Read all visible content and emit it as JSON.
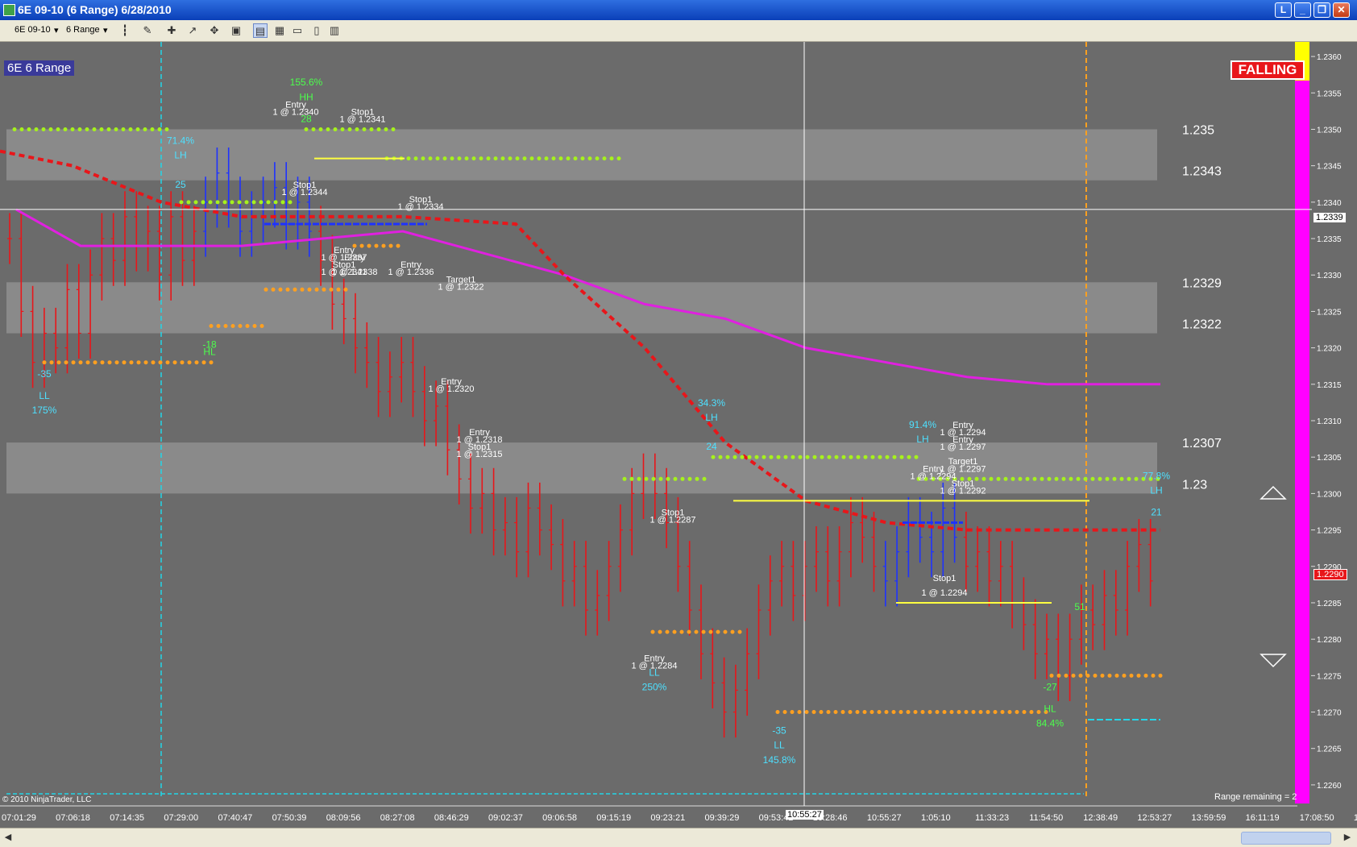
{
  "window": {
    "title": "6E 09-10 (6 Range)  6/28/2010",
    "btn_l": "L"
  },
  "toolbar": {
    "instrument": "6E 09-10",
    "period": "6 Range"
  },
  "chart": {
    "label": "6E 6 Range",
    "status": "FALLING",
    "copyright": "© 2010 NinjaTrader, LLC",
    "range_remaining": "Range remaining = 2",
    "crosshair_time": "10:55:27",
    "crosshair_price": "1.2339",
    "current_price": "1.2290"
  },
  "chart_data": {
    "type": "bar",
    "title": "",
    "ylim": [
      1.2258,
      1.2362
    ],
    "y_ticks": [
      1.236,
      1.2355,
      1.235,
      1.2345,
      1.234,
      1.2335,
      1.233,
      1.2325,
      1.232,
      1.2315,
      1.231,
      1.2305,
      1.23,
      1.2295,
      1.229,
      1.2285,
      1.228,
      1.2275,
      1.227,
      1.2265,
      1.226
    ],
    "x_labels": [
      "07:01:29",
      "07:06:18",
      "07:14:35",
      "07:29:00",
      "07:40:47",
      "07:50:39",
      "08:09:56",
      "08:27:08",
      "08:46:29",
      "09:02:37",
      "09:06:58",
      "09:15:19",
      "09:23:21",
      "09:39:29",
      "09:53:42",
      "10:28:46",
      "10:55:27",
      "1:05:10",
      "11:33:23",
      "11:54:50",
      "12:38:49",
      "12:53:27",
      "13:59:59",
      "16:11:19",
      "17:08:50",
      "17:14:55"
    ],
    "zones": [
      {
        "from": 1.2343,
        "to": 1.235,
        "label": "1.2343",
        "label_hi": "1.235"
      },
      {
        "from": 1.2322,
        "to": 1.2329,
        "label": "1.2322",
        "label_hi": "1.2329"
      },
      {
        "from": 1.23,
        "to": 1.2307,
        "label": "1.23",
        "label_hi": "1.2307"
      }
    ],
    "price_path": [
      1.2335,
      1.2325,
      1.2318,
      1.2322,
      1.232,
      1.2328,
      1.2322,
      1.233,
      1.2335,
      1.2332,
      1.2338,
      1.2334,
      1.2336,
      1.233,
      1.2338,
      1.2332,
      1.2336,
      1.234,
      1.2344,
      1.234,
      1.2336,
      1.2338,
      1.234,
      1.2342,
      1.2337,
      1.234,
      1.2336,
      1.2332,
      1.2326,
      1.2324,
      1.232,
      1.2318,
      1.2314,
      1.2316,
      1.2318,
      1.2314,
      1.231,
      1.2312,
      1.2306,
      1.2302,
      1.2298,
      1.23,
      1.2295,
      1.2296,
      1.2292,
      1.2298,
      1.2295,
      1.2293,
      1.2288,
      1.229,
      1.2284,
      1.2286,
      1.229,
      1.2295,
      1.23,
      1.2302,
      1.23,
      1.2296,
      1.229,
      1.2284,
      1.2278,
      1.2274,
      1.227,
      1.2273,
      1.2278,
      1.2284,
      1.2288,
      1.229,
      1.2286,
      1.229,
      1.2292,
      1.2288,
      1.2292,
      1.2296,
      1.2294,
      1.229,
      1.2288,
      1.2292,
      1.2296,
      1.2294,
      1.2292,
      1.2298,
      1.2294,
      1.229,
      1.2292,
      1.2288,
      1.229,
      1.2285,
      1.2282,
      1.2278,
      1.228,
      1.2275,
      1.228,
      1.2284,
      1.2282,
      1.2286,
      1.2284,
      1.229,
      1.2293,
      1.2288
    ],
    "ema_red": [
      [
        0,
        1.2347
      ],
      [
        90,
        1.2345
      ],
      [
        200,
        1.234
      ],
      [
        300,
        1.2338
      ],
      [
        500,
        1.2338
      ],
      [
        640,
        1.2337
      ],
      [
        700,
        1.233
      ],
      [
        800,
        1.232
      ],
      [
        900,
        1.2307
      ],
      [
        1000,
        1.2299
      ],
      [
        1100,
        1.2296
      ],
      [
        1200,
        1.2295
      ],
      [
        1440,
        1.2295
      ]
    ],
    "ema_magenta": [
      [
        20,
        1.2339
      ],
      [
        100,
        1.2334
      ],
      [
        300,
        1.2334
      ],
      [
        500,
        1.2336
      ],
      [
        700,
        1.233
      ],
      [
        800,
        1.2326
      ],
      [
        900,
        1.2324
      ],
      [
        1000,
        1.232
      ],
      [
        1100,
        1.2318
      ],
      [
        1200,
        1.2316
      ],
      [
        1300,
        1.2315
      ],
      [
        1440,
        1.2315
      ]
    ],
    "dot_levels": [
      {
        "x1": 18,
        "x2": 215,
        "y": 1.235,
        "color": "#a6f21c"
      },
      {
        "x1": 380,
        "x2": 490,
        "y": 1.235,
        "color": "#a6f21c"
      },
      {
        "x1": 480,
        "x2": 770,
        "y": 1.2346,
        "color": "#a6f21c"
      },
      {
        "x1": 225,
        "x2": 360,
        "y": 1.234,
        "color": "#a6f21c"
      },
      {
        "x1": 330,
        "x2": 430,
        "y": 1.2328,
        "color": "#ffa020"
      },
      {
        "x1": 262,
        "x2": 325,
        "y": 1.2323,
        "color": "#ffa020"
      },
      {
        "x1": 55,
        "x2": 262,
        "y": 1.2318,
        "color": "#ffa020"
      },
      {
        "x1": 440,
        "x2": 500,
        "y": 1.2334,
        "color": "#ffa020"
      },
      {
        "x1": 775,
        "x2": 880,
        "y": 1.2302,
        "color": "#a6f21c"
      },
      {
        "x1": 885,
        "x2": 1140,
        "y": 1.2305,
        "color": "#a6f21c"
      },
      {
        "x1": 1140,
        "x2": 1440,
        "y": 1.2302,
        "color": "#a6f21c"
      },
      {
        "x1": 810,
        "x2": 925,
        "y": 1.2281,
        "color": "#ffa020"
      },
      {
        "x1": 965,
        "x2": 1300,
        "y": 1.227,
        "color": "#ffa020"
      },
      {
        "x1": 1305,
        "x2": 1440,
        "y": 1.2275,
        "color": "#ffa020"
      }
    ],
    "labels": [
      {
        "x": 380,
        "y": 1.2356,
        "t": "155.6%",
        "c": "#4cff4c"
      },
      {
        "x": 380,
        "y": 1.2354,
        "t": "HH",
        "c": "#4cff4c"
      },
      {
        "x": 380,
        "y": 1.2351,
        "t": "28",
        "c": "#4cff4c"
      },
      {
        "x": 224,
        "y": 1.2348,
        "t": "71.4%",
        "c": "#4ee0ff"
      },
      {
        "x": 224,
        "y": 1.2346,
        "t": "LH",
        "c": "#4ee0ff"
      },
      {
        "x": 224,
        "y": 1.2342,
        "t": "25",
        "c": "#4ee0ff"
      },
      {
        "x": 260,
        "y": 1.2319,
        "t": "HL",
        "c": "#4cff4c"
      },
      {
        "x": 260,
        "y": 1.232,
        "t": "-18",
        "c": "#4cff4c"
      },
      {
        "x": 55,
        "y": 1.2316,
        "t": "-35",
        "c": "#4ee0ff"
      },
      {
        "x": 55,
        "y": 1.2313,
        "t": "LL",
        "c": "#4ee0ff"
      },
      {
        "x": 55,
        "y": 1.2311,
        "t": "175%",
        "c": "#4ee0ff"
      },
      {
        "x": 883,
        "y": 1.2312,
        "t": "34.3%",
        "c": "#4ee0ff"
      },
      {
        "x": 883,
        "y": 1.231,
        "t": "LH",
        "c": "#4ee0ff"
      },
      {
        "x": 883,
        "y": 1.2306,
        "t": "24",
        "c": "#4ee0ff"
      },
      {
        "x": 1145,
        "y": 1.2309,
        "t": "91.4%",
        "c": "#4ee0ff"
      },
      {
        "x": 1145,
        "y": 1.2307,
        "t": "LH",
        "c": "#4ee0ff"
      },
      {
        "x": 812,
        "y": 1.2275,
        "t": "LL",
        "c": "#4ee0ff"
      },
      {
        "x": 812,
        "y": 1.2273,
        "t": "250%",
        "c": "#4ee0ff"
      },
      {
        "x": 967,
        "y": 1.2267,
        "t": "-35",
        "c": "#4ee0ff"
      },
      {
        "x": 967,
        "y": 1.2265,
        "t": "LL",
        "c": "#4ee0ff"
      },
      {
        "x": 967,
        "y": 1.2263,
        "t": "145.8%",
        "c": "#4ee0ff"
      },
      {
        "x": 1303,
        "y": 1.2273,
        "t": "-27",
        "c": "#4cff4c"
      },
      {
        "x": 1303,
        "y": 1.227,
        "t": "HL",
        "c": "#4cff4c"
      },
      {
        "x": 1303,
        "y": 1.2268,
        "t": "84.4%",
        "c": "#4cff4c"
      },
      {
        "x": 1435,
        "y": 1.2302,
        "t": "77.8%",
        "c": "#4ee0ff"
      },
      {
        "x": 1435,
        "y": 1.23,
        "t": "LH",
        "c": "#4ee0ff"
      },
      {
        "x": 1435,
        "y": 1.2297,
        "t": "21",
        "c": "#4ee0ff"
      },
      {
        "x": 1340,
        "y": 1.2284,
        "t": "51",
        "c": "#4cff4c"
      }
    ],
    "trades": [
      {
        "x": 367,
        "y": 1.2353,
        "t": "Entry"
      },
      {
        "x": 367,
        "y": 1.2352,
        "t": "1 @ 1.2340"
      },
      {
        "x": 450,
        "y": 1.2352,
        "t": "Stop1"
      },
      {
        "x": 450,
        "y": 1.2351,
        "t": "1 @ 1.2341"
      },
      {
        "x": 378,
        "y": 1.2342,
        "t": "Stop1"
      },
      {
        "x": 378,
        "y": 1.2341,
        "t": "1 @ 1.2344"
      },
      {
        "x": 522,
        "y": 1.234,
        "t": "Stop1"
      },
      {
        "x": 522,
        "y": 1.2339,
        "t": "1 @ 1.2334"
      },
      {
        "x": 427,
        "y": 1.2333,
        "t": "Entry"
      },
      {
        "x": 427,
        "y": 1.2332,
        "t": "1 @ 1.2337"
      },
      {
        "x": 440,
        "y": 1.2332,
        "t": "Entry"
      },
      {
        "x": 440,
        "y": 1.233,
        "t": "1 @ 1.2338"
      },
      {
        "x": 427,
        "y": 1.2331,
        "t": "Stop1"
      },
      {
        "x": 427,
        "y": 1.233,
        "t": "1 @ 1.2341"
      },
      {
        "x": 510,
        "y": 1.2331,
        "t": "Entry"
      },
      {
        "x": 510,
        "y": 1.233,
        "t": "1 @ 1.2336"
      },
      {
        "x": 572,
        "y": 1.2329,
        "t": "Target1"
      },
      {
        "x": 572,
        "y": 1.2328,
        "t": "1 @ 1.2322"
      },
      {
        "x": 560,
        "y": 1.2315,
        "t": "Entry"
      },
      {
        "x": 560,
        "y": 1.2314,
        "t": "1 @ 1.2320"
      },
      {
        "x": 595,
        "y": 1.2308,
        "t": "Entry"
      },
      {
        "x": 595,
        "y": 1.2307,
        "t": "1 @ 1.2318"
      },
      {
        "x": 595,
        "y": 1.2306,
        "t": "Stop1"
      },
      {
        "x": 595,
        "y": 1.2305,
        "t": "1 @ 1.2315"
      },
      {
        "x": 835,
        "y": 1.2297,
        "t": "Stop1"
      },
      {
        "x": 835,
        "y": 1.2296,
        "t": "1 @ 1.2287"
      },
      {
        "x": 812,
        "y": 1.2277,
        "t": "Entry"
      },
      {
        "x": 812,
        "y": 1.2276,
        "t": "1 @ 1.2284"
      },
      {
        "x": 1195,
        "y": 1.2309,
        "t": "Entry"
      },
      {
        "x": 1195,
        "y": 1.2308,
        "t": "1 @ 1.2294"
      },
      {
        "x": 1195,
        "y": 1.2307,
        "t": "Entry"
      },
      {
        "x": 1195,
        "y": 1.2306,
        "t": "1 @ 1.2297"
      },
      {
        "x": 1195,
        "y": 1.2304,
        "t": "Target1"
      },
      {
        "x": 1195,
        "y": 1.2303,
        "t": "1 @ 1.2297"
      },
      {
        "x": 1195,
        "y": 1.2301,
        "t": "Stop1"
      },
      {
        "x": 1195,
        "y": 1.23,
        "t": "1 @ 1.2292"
      },
      {
        "x": 1158,
        "y": 1.2303,
        "t": "Entry"
      },
      {
        "x": 1158,
        "y": 1.2302,
        "t": "1 @ 1.2294"
      },
      {
        "x": 1172,
        "y": 1.2288,
        "t": "Stop1"
      },
      {
        "x": 1172,
        "y": 1.2286,
        "t": "1 @ 1.2294"
      }
    ],
    "yellow_lines": [
      {
        "x1": 390,
        "x2": 502,
        "y": 1.2346
      },
      {
        "x1": 910,
        "x2": 1352,
        "y": 1.2299
      },
      {
        "x1": 1112,
        "x2": 1305,
        "y": 1.2285
      }
    ],
    "blue_lines": [
      {
        "x1": 328,
        "x2": 530,
        "y": 1.2337
      },
      {
        "x1": 1120,
        "x2": 1195,
        "y": 1.2296
      }
    ]
  }
}
